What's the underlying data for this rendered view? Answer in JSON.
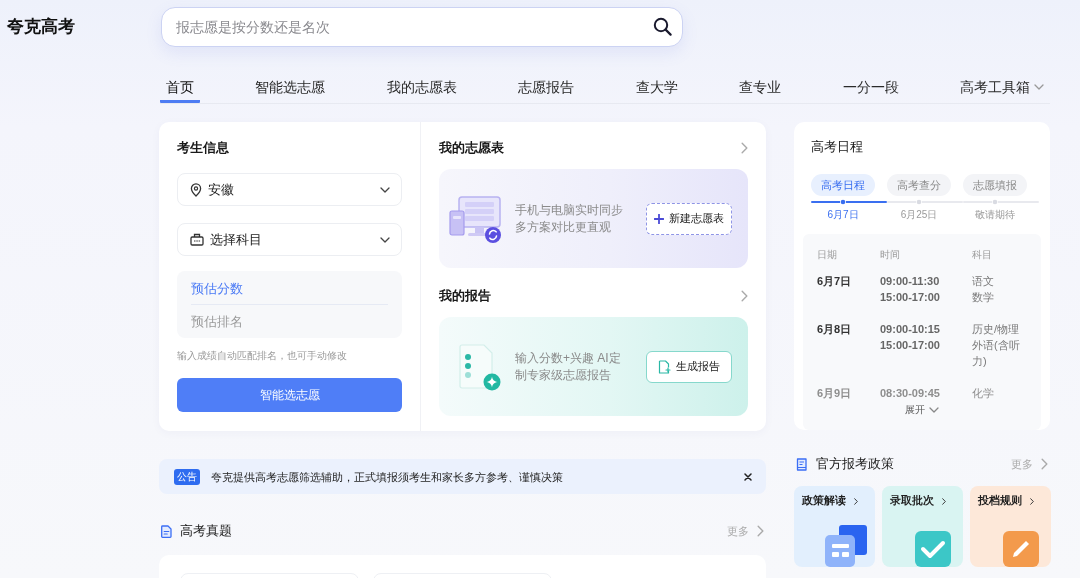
{
  "header": {
    "logo": "夸克高考",
    "search": {
      "placeholder": "报志愿是按分数还是名次"
    }
  },
  "nav": [
    {
      "label": "首页",
      "selected": true,
      "dropdown": false
    },
    {
      "label": "智能选志愿",
      "selected": false,
      "dropdown": false
    },
    {
      "label": "我的志愿表",
      "selected": false,
      "dropdown": false
    },
    {
      "label": "志愿报告",
      "selected": false,
      "dropdown": false
    },
    {
      "label": "查大学",
      "selected": false,
      "dropdown": false
    },
    {
      "label": "查专业",
      "selected": false,
      "dropdown": false
    },
    {
      "label": "一分一段",
      "selected": false,
      "dropdown": false
    },
    {
      "label": "高考工具箱",
      "selected": false,
      "dropdown": true
    }
  ],
  "student_info": {
    "title": "考生信息",
    "province": {
      "value": "安徽"
    },
    "subjects": {
      "placeholder": "选择科目"
    },
    "score": {
      "placeholder": "预估分数",
      "focused": true
    },
    "rank": {
      "placeholder": "预估排名",
      "focused": false
    },
    "hint": "输入成绩自动匹配排名，也可手动修改",
    "button": "智能选志愿"
  },
  "my_table": {
    "title": "我的志愿表",
    "description": "手机与电脑实时同步多方案对比更直观",
    "button": "新建志愿表"
  },
  "my_report": {
    "title": "我的报告",
    "description": "输入分数+兴趣 AI定制专家级志愿报告",
    "button": "生成报告"
  },
  "schedule": {
    "title": "高考日程",
    "tabs": [
      {
        "label": "高考日程",
        "selected": true
      },
      {
        "label": "高考查分",
        "selected": false
      },
      {
        "label": "志愿填报",
        "selected": false
      }
    ],
    "timeline": [
      {
        "date": "6月7日",
        "selected": true
      },
      {
        "date": "6月25日",
        "selected": false
      },
      {
        "date": "敬请期待",
        "selected": false
      }
    ],
    "columns": [
      "日期",
      "时间",
      "科目"
    ],
    "rows": [
      {
        "date": "6月7日",
        "times": [
          "09:00-11:30",
          "15:00-17:00"
        ],
        "subjects": [
          "语文",
          "数学"
        ],
        "faded": false
      },
      {
        "date": "6月8日",
        "times": [
          "09:00-10:15",
          "15:00-17:00"
        ],
        "subjects": [
          "历史/物理",
          "外语(含听力)"
        ],
        "faded": false
      },
      {
        "date": "6月9日",
        "times": [
          "08:30-09:45"
        ],
        "subjects": [
          "化学"
        ],
        "faded": true
      }
    ],
    "expand": "展开"
  },
  "notice": {
    "badge": "公告",
    "text": "夸克提供高考志愿筛选辅助，正式填报须考生和家长多方参考、谨慎决策"
  },
  "exam_papers": {
    "title": "高考真题",
    "more": "更多"
  },
  "policy": {
    "title": "官方报考政策",
    "more": "更多",
    "tiles": [
      {
        "label": "政策解读",
        "kind": "form",
        "color": "#e2effd"
      },
      {
        "label": "录取批次",
        "kind": "check",
        "color": "#d9f4f2"
      },
      {
        "label": "投档规则",
        "kind": "pen",
        "color": "#fde8d9"
      }
    ]
  }
}
